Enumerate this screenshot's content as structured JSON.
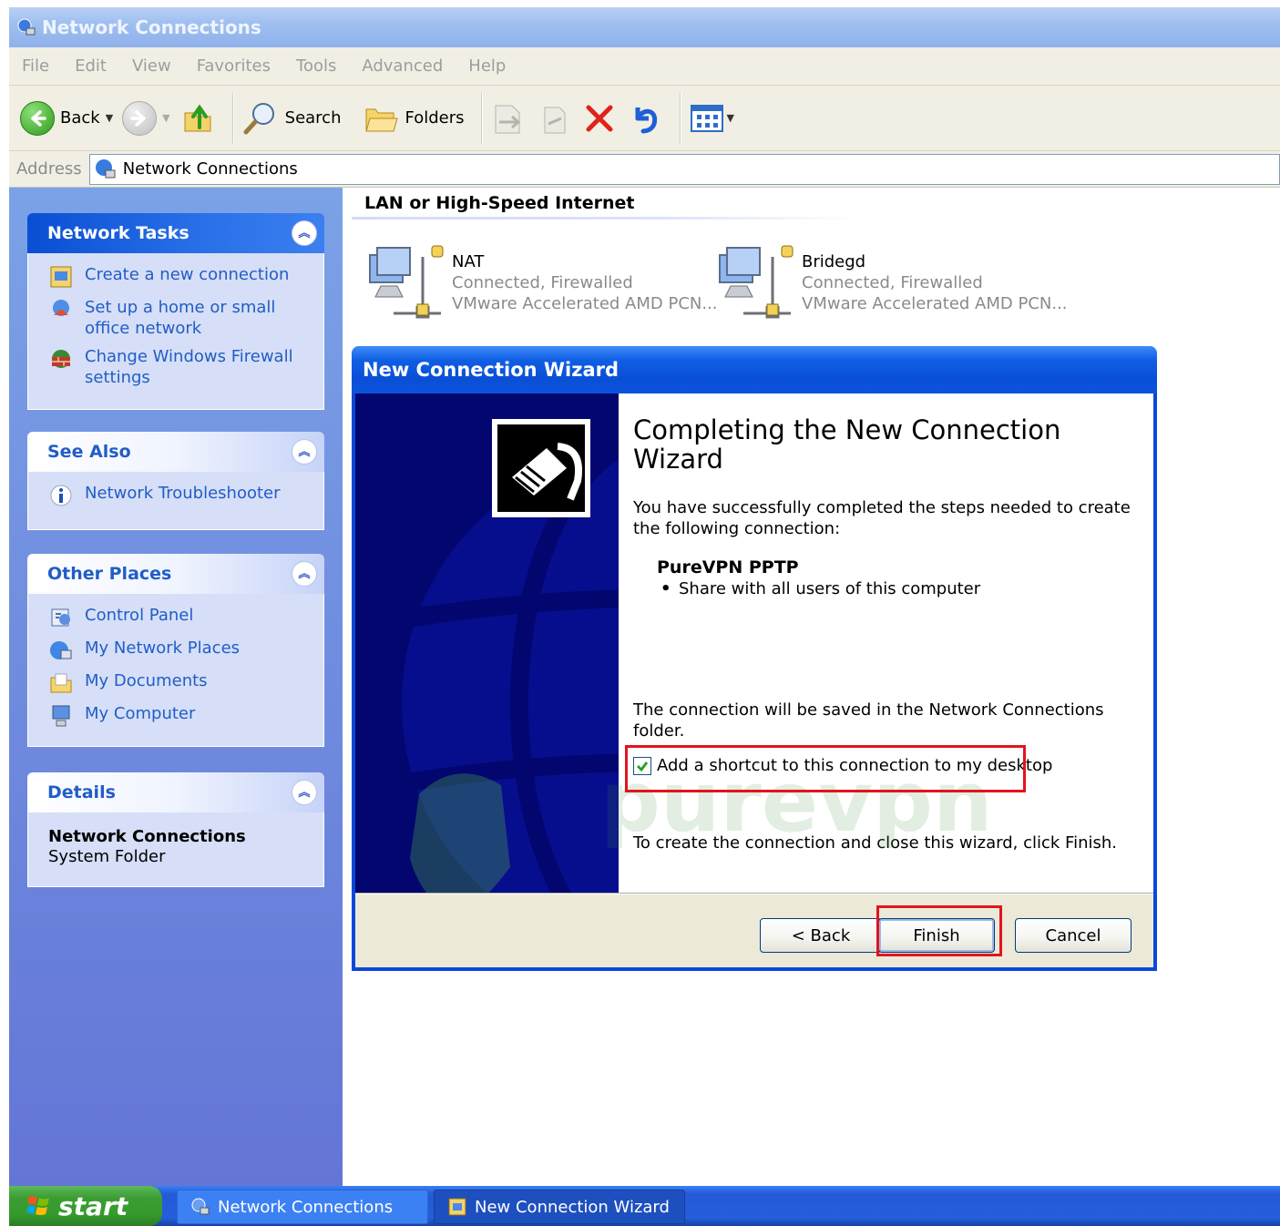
{
  "window": {
    "title": "Network Connections"
  },
  "menu": [
    "File",
    "Edit",
    "View",
    "Favorites",
    "Tools",
    "Advanced",
    "Help"
  ],
  "toolbar": {
    "back": "Back",
    "search": "Search",
    "folders": "Folders"
  },
  "address": {
    "label": "Address",
    "value": "Network Connections"
  },
  "sidebar": {
    "network_tasks": {
      "title": "Network Tasks",
      "items": [
        {
          "label": "Create a new connection",
          "icon": "new-connection-icon"
        },
        {
          "label": "Set up a home or small office network",
          "icon": "home-network-icon"
        },
        {
          "label": "Change Windows Firewall settings",
          "icon": "firewall-icon"
        }
      ]
    },
    "see_also": {
      "title": "See Also",
      "items": [
        {
          "label": "Network Troubleshooter",
          "icon": "info-icon"
        }
      ]
    },
    "other_places": {
      "title": "Other Places",
      "items": [
        {
          "label": "Control Panel",
          "icon": "control-panel-icon"
        },
        {
          "label": "My Network Places",
          "icon": "network-places-icon"
        },
        {
          "label": "My Documents",
          "icon": "documents-icon"
        },
        {
          "label": "My Computer",
          "icon": "computer-icon"
        }
      ]
    },
    "details": {
      "title": "Details",
      "name": "Network Connections",
      "type": "System Folder"
    }
  },
  "main": {
    "group_title": "LAN or High-Speed Internet",
    "connections": [
      {
        "name": "NAT",
        "status": "Connected, Firewalled",
        "device": "VMware Accelerated AMD PCN..."
      },
      {
        "name": "Bridegd",
        "status": "Connected, Firewalled",
        "device": "VMware Accelerated AMD PCN..."
      }
    ]
  },
  "wizard": {
    "title": "New Connection Wizard",
    "heading": "Completing the New Connection Wizard",
    "intro": "You have successfully completed the steps needed to create the following connection:",
    "connection_name": "PureVPN PPTP",
    "bullet": "Share with all users of this computer",
    "saved_note": "The connection will be saved in the Network Connections folder.",
    "shortcut_label": "Add a shortcut to this connection to my desktop",
    "shortcut_checked": true,
    "finish_note": "To create the connection and close this wizard, click Finish.",
    "buttons": {
      "back": "< Back",
      "finish": "Finish",
      "cancel": "Cancel"
    }
  },
  "taskbar": {
    "start": "start",
    "tasks": [
      {
        "label": "Network Connections",
        "active": false
      },
      {
        "label": "New Connection Wizard",
        "active": true
      }
    ]
  },
  "watermark": "purevpn",
  "colors": {
    "xp_blue": "#0a4fd6",
    "highlight_red": "#e2141c",
    "link_blue": "#215dc6",
    "start_green": "#3b9c33"
  }
}
